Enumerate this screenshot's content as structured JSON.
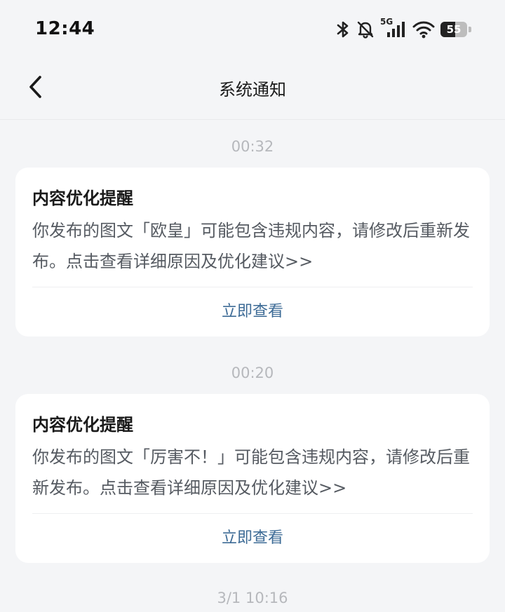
{
  "status_bar": {
    "time": "12:44",
    "network": "5G",
    "battery": "55",
    "battery_level": 0.55,
    "icons": [
      "bluetooth-icon",
      "bell-off-icon",
      "signal-5g-icon",
      "wifi-icon",
      "battery-icon"
    ]
  },
  "header": {
    "title": "系统通知",
    "back_icon": "chevron-left-icon"
  },
  "notifications": [
    {
      "time": "00:32",
      "title": "内容优化提醒",
      "text": "你发布的图文「欧皇」可能包含违规内容，请修改后重新发布。点击查看详细原因及优化建议>>",
      "action": "立即查看"
    },
    {
      "time": "00:20",
      "title": "内容优化提醒",
      "text": "你发布的图文「厉害不！」可能包含违规内容，请修改后重新发布。点击查看详细原因及优化建议>>",
      "action": "立即查看"
    },
    {
      "time": "3/1 10:16"
    }
  ],
  "colors": {
    "background": "#f4f5f7",
    "card": "#ffffff",
    "action_link": "#3d6b96",
    "timestamp": "#b6b8bc",
    "body_text": "#555a61"
  }
}
